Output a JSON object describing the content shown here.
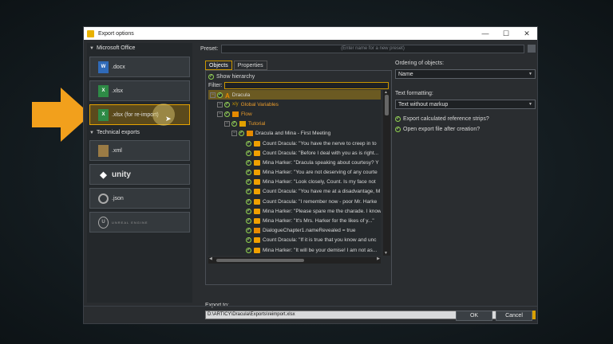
{
  "window": {
    "title": "Export options",
    "controls": [
      "—",
      "☐",
      "✕"
    ]
  },
  "left": {
    "ms_office_header": "Microsoft Office",
    "technical_header": "Technical exports",
    "buttons": [
      {
        "label": ".docx",
        "icon": "word-icon",
        "glyph": "W"
      },
      {
        "label": ".xlsx",
        "icon": "excel-icon",
        "glyph": "X"
      },
      {
        "label": ".xlsx (for re-import)",
        "icon": "excel-reimport-icon",
        "glyph": "X"
      },
      {
        "label": ".xml",
        "icon": "xml-icon",
        "glyph": ""
      },
      {
        "label": "unity",
        "icon": "unity-icon",
        "glyph": "◆"
      },
      {
        "label": ".json",
        "icon": "json-icon",
        "glyph": ""
      },
      {
        "label": "UNREAL ENGINE",
        "icon": "unreal-icon",
        "glyph": "U"
      }
    ]
  },
  "preset": {
    "label": "Preset:",
    "placeholder": "(Enter name for a new preset)"
  },
  "tabs": [
    "Objects",
    "Properties"
  ],
  "objects": {
    "show_hierarchy": "Show hierarchy",
    "filter_label": "Filter:",
    "tree": [
      {
        "text": "Dracula",
        "indent": 0,
        "icon": "dracula"
      },
      {
        "text": "Global Variables",
        "indent": 1,
        "icon": "var"
      },
      {
        "text": "Flow",
        "indent": 1,
        "icon": "flow"
      },
      {
        "text": "Tutorial",
        "indent": 2,
        "icon": "folder"
      },
      {
        "text": "Dracula and Mina - First Meeting",
        "indent": 3,
        "icon": "flow"
      },
      {
        "text": "Count Dracula: \"You have the nerve to creep in to",
        "indent": 4,
        "icon": "bubble"
      },
      {
        "text": "Count Dracula: \"Before I deal with you as is right...",
        "indent": 4,
        "icon": "bubble"
      },
      {
        "text": "Mina Harker: \"Dracula speaking about courtesy? Y",
        "indent": 4,
        "icon": "bubble"
      },
      {
        "text": "Mina Harker: \"You are not deserving of any courte",
        "indent": 4,
        "icon": "bubble"
      },
      {
        "text": "Mina Harker: \"Look closely, Count. Is my face not",
        "indent": 4,
        "icon": "bubble"
      },
      {
        "text": "Count Dracula: \"You have me at a disadvantage, M",
        "indent": 4,
        "icon": "bubble"
      },
      {
        "text": "Count Dracula: \"I remember now - poor Mr. Harke",
        "indent": 4,
        "icon": "bubble"
      },
      {
        "text": "Mina Harker: \"Please spare me the charade. I know",
        "indent": 4,
        "icon": "bubble"
      },
      {
        "text": "Mina Harker: \"It's Mrs. Harker for the likes of y...\"",
        "indent": 4,
        "icon": "bubble"
      },
      {
        "text": "DialogueChapter1.nameRevealed = true",
        "indent": 4,
        "icon": "instruction"
      },
      {
        "text": "Count Dracula: \"If it is true that you know and unc",
        "indent": 4,
        "icon": "bubble"
      },
      {
        "text": "Mina Harker: \"It will be your demise! I am not as...",
        "indent": 4,
        "icon": "bubble"
      }
    ]
  },
  "options": {
    "ordering_label": "Ordering of objects:",
    "ordering_value": "Name",
    "formatting_label": "Text formatting:",
    "formatting_value": "Text without markup",
    "check1": "Export calculated reference strips?",
    "check2": "Open export file after creation?"
  },
  "export": {
    "label": "Export to:",
    "path": "D:\\ARTICY\\Dracula\\Exports\\reimport.xlsx"
  },
  "footer": {
    "ok": "OK",
    "cancel": "Cancel"
  },
  "colors": {
    "accent": "#e6a200",
    "arrow": "#f2a01c",
    "check": "#8fd14f"
  }
}
